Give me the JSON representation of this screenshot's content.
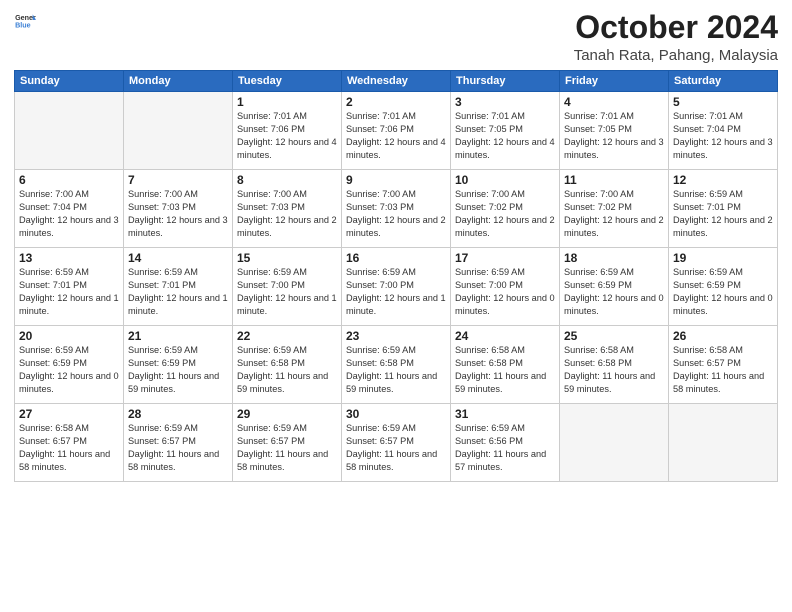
{
  "logo": {
    "line1": "General",
    "line2": "Blue"
  },
  "title": "October 2024",
  "location": "Tanah Rata, Pahang, Malaysia",
  "days_of_week": [
    "Sunday",
    "Monday",
    "Tuesday",
    "Wednesday",
    "Thursday",
    "Friday",
    "Saturday"
  ],
  "weeks": [
    [
      {
        "day": "",
        "info": ""
      },
      {
        "day": "",
        "info": ""
      },
      {
        "day": "1",
        "info": "Sunrise: 7:01 AM\nSunset: 7:06 PM\nDaylight: 12 hours\nand 4 minutes."
      },
      {
        "day": "2",
        "info": "Sunrise: 7:01 AM\nSunset: 7:06 PM\nDaylight: 12 hours\nand 4 minutes."
      },
      {
        "day": "3",
        "info": "Sunrise: 7:01 AM\nSunset: 7:05 PM\nDaylight: 12 hours\nand 4 minutes."
      },
      {
        "day": "4",
        "info": "Sunrise: 7:01 AM\nSunset: 7:05 PM\nDaylight: 12 hours\nand 3 minutes."
      },
      {
        "day": "5",
        "info": "Sunrise: 7:01 AM\nSunset: 7:04 PM\nDaylight: 12 hours\nand 3 minutes."
      }
    ],
    [
      {
        "day": "6",
        "info": "Sunrise: 7:00 AM\nSunset: 7:04 PM\nDaylight: 12 hours\nand 3 minutes."
      },
      {
        "day": "7",
        "info": "Sunrise: 7:00 AM\nSunset: 7:03 PM\nDaylight: 12 hours\nand 3 minutes."
      },
      {
        "day": "8",
        "info": "Sunrise: 7:00 AM\nSunset: 7:03 PM\nDaylight: 12 hours\nand 2 minutes."
      },
      {
        "day": "9",
        "info": "Sunrise: 7:00 AM\nSunset: 7:03 PM\nDaylight: 12 hours\nand 2 minutes."
      },
      {
        "day": "10",
        "info": "Sunrise: 7:00 AM\nSunset: 7:02 PM\nDaylight: 12 hours\nand 2 minutes."
      },
      {
        "day": "11",
        "info": "Sunrise: 7:00 AM\nSunset: 7:02 PM\nDaylight: 12 hours\nand 2 minutes."
      },
      {
        "day": "12",
        "info": "Sunrise: 6:59 AM\nSunset: 7:01 PM\nDaylight: 12 hours\nand 2 minutes."
      }
    ],
    [
      {
        "day": "13",
        "info": "Sunrise: 6:59 AM\nSunset: 7:01 PM\nDaylight: 12 hours\nand 1 minute."
      },
      {
        "day": "14",
        "info": "Sunrise: 6:59 AM\nSunset: 7:01 PM\nDaylight: 12 hours\nand 1 minute."
      },
      {
        "day": "15",
        "info": "Sunrise: 6:59 AM\nSunset: 7:00 PM\nDaylight: 12 hours\nand 1 minute."
      },
      {
        "day": "16",
        "info": "Sunrise: 6:59 AM\nSunset: 7:00 PM\nDaylight: 12 hours\nand 1 minute."
      },
      {
        "day": "17",
        "info": "Sunrise: 6:59 AM\nSunset: 7:00 PM\nDaylight: 12 hours\nand 0 minutes."
      },
      {
        "day": "18",
        "info": "Sunrise: 6:59 AM\nSunset: 6:59 PM\nDaylight: 12 hours\nand 0 minutes."
      },
      {
        "day": "19",
        "info": "Sunrise: 6:59 AM\nSunset: 6:59 PM\nDaylight: 12 hours\nand 0 minutes."
      }
    ],
    [
      {
        "day": "20",
        "info": "Sunrise: 6:59 AM\nSunset: 6:59 PM\nDaylight: 12 hours\nand 0 minutes."
      },
      {
        "day": "21",
        "info": "Sunrise: 6:59 AM\nSunset: 6:59 PM\nDaylight: 11 hours\nand 59 minutes."
      },
      {
        "day": "22",
        "info": "Sunrise: 6:59 AM\nSunset: 6:58 PM\nDaylight: 11 hours\nand 59 minutes."
      },
      {
        "day": "23",
        "info": "Sunrise: 6:59 AM\nSunset: 6:58 PM\nDaylight: 11 hours\nand 59 minutes."
      },
      {
        "day": "24",
        "info": "Sunrise: 6:58 AM\nSunset: 6:58 PM\nDaylight: 11 hours\nand 59 minutes."
      },
      {
        "day": "25",
        "info": "Sunrise: 6:58 AM\nSunset: 6:58 PM\nDaylight: 11 hours\nand 59 minutes."
      },
      {
        "day": "26",
        "info": "Sunrise: 6:58 AM\nSunset: 6:57 PM\nDaylight: 11 hours\nand 58 minutes."
      }
    ],
    [
      {
        "day": "27",
        "info": "Sunrise: 6:58 AM\nSunset: 6:57 PM\nDaylight: 11 hours\nand 58 minutes."
      },
      {
        "day": "28",
        "info": "Sunrise: 6:59 AM\nSunset: 6:57 PM\nDaylight: 11 hours\nand 58 minutes."
      },
      {
        "day": "29",
        "info": "Sunrise: 6:59 AM\nSunset: 6:57 PM\nDaylight: 11 hours\nand 58 minutes."
      },
      {
        "day": "30",
        "info": "Sunrise: 6:59 AM\nSunset: 6:57 PM\nDaylight: 11 hours\nand 58 minutes."
      },
      {
        "day": "31",
        "info": "Sunrise: 6:59 AM\nSunset: 6:56 PM\nDaylight: 11 hours\nand 57 minutes."
      },
      {
        "day": "",
        "info": ""
      },
      {
        "day": "",
        "info": ""
      }
    ]
  ]
}
